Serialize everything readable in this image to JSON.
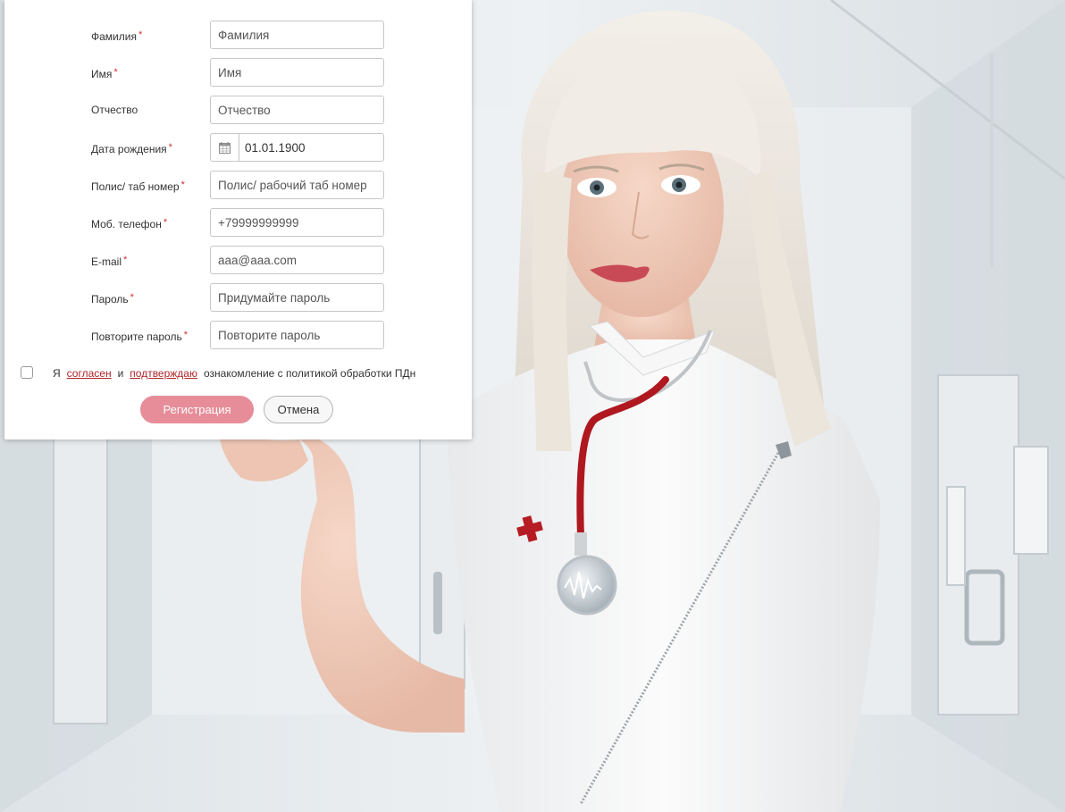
{
  "form": {
    "fields": [
      {
        "label": "Фамилия",
        "required": "*",
        "placeholder": "Фамилия",
        "value": ""
      },
      {
        "label": "Имя",
        "required": "*",
        "placeholder": "Имя",
        "value": ""
      },
      {
        "label": "Отчество",
        "required": "",
        "placeholder": "Отчество",
        "value": ""
      },
      {
        "label": "Дата рождения",
        "required": "*",
        "placeholder": "",
        "value": "01.01.1900"
      },
      {
        "label": "Полис/ таб номер",
        "required": "*",
        "placeholder": "Полис/ рабочий таб номер",
        "value": ""
      },
      {
        "label": "Моб. телефон",
        "required": "*",
        "placeholder": "+79999999999",
        "value": ""
      },
      {
        "label": "E-mail",
        "required": "*",
        "placeholder": "aaa@aaa.com",
        "value": ""
      },
      {
        "label": "Пароль",
        "required": "*",
        "placeholder": "Придумайте пароль",
        "value": ""
      },
      {
        "label": "Повторите пароль",
        "required": "*",
        "placeholder": "Повторите пароль",
        "value": ""
      }
    ],
    "date_icon": "calendar-icon"
  },
  "consent": {
    "prefix": "Я",
    "link_agree": "согласен",
    "conjunction": "и",
    "link_confirm": "подтверждаю",
    "suffix": "ознакомление с политикой обработки ПДн",
    "checked": false
  },
  "buttons": {
    "register": "Регистрация",
    "cancel": "Отмена"
  },
  "colors": {
    "register_button": "#e68d99",
    "link": "#b0252a",
    "required_marker": "#d32f2f"
  }
}
